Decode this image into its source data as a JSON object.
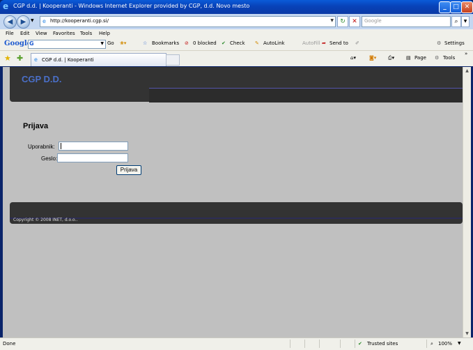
{
  "window": {
    "title": "CGP d.d. | Kooperanti - Windows Internet Explorer provided by CGP, d.d. Novo mesto"
  },
  "address": {
    "url": "http://kooperanti.cgp.si/",
    "search_placeholder": "Google"
  },
  "menu": [
    "File",
    "Edit",
    "View",
    "Favorites",
    "Tools",
    "Help"
  ],
  "google_toolbar": {
    "logo": "Google",
    "go_label": "Go",
    "bookmarks": "Bookmarks",
    "blocked": "0 blocked",
    "check": "Check",
    "autolink": "AutoLink",
    "autofill": "AutoFill",
    "send_to": "Send to",
    "settings": "Settings"
  },
  "tabs": [
    {
      "label": "CGP d.d. | Kooperanti"
    }
  ],
  "command_bar": {
    "page": "Page",
    "tools": "Tools"
  },
  "page": {
    "brand": "CGP D.D.",
    "login": {
      "title": "Prijava",
      "username_label": "Uporabnik:",
      "username_value": "",
      "password_label": "Geslo:",
      "password_value": "",
      "submit_label": "Prijava"
    },
    "footer": "Copyright © 2008 INET, d.o.o.."
  },
  "status": {
    "text": "Done",
    "zone": "Trusted sites",
    "zoom": "100%"
  }
}
